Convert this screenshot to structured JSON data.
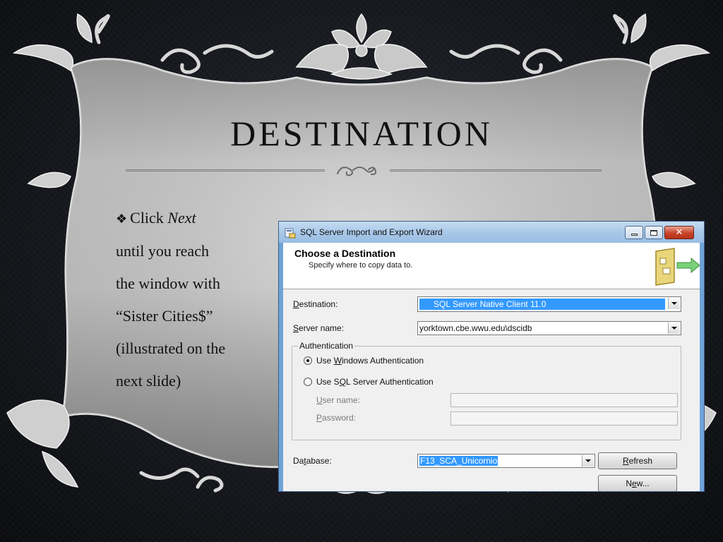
{
  "slide": {
    "title": "DESTINATION",
    "bullet_symbol": "❖",
    "bullet_lines": [
      {
        "pre": "Click ",
        "em": "Next"
      },
      {
        "text": "until you reach"
      },
      {
        "text": "the window with"
      },
      {
        "text": "“Sister Cities$”"
      },
      {
        "text": "(illustrated on the"
      },
      {
        "text": "next slide)"
      }
    ]
  },
  "dialog": {
    "window_title": "SQL Server Import and Export Wizard",
    "header_title": "Choose a Destination",
    "header_subtitle": "Specify where to copy data to.",
    "destination_label_u": "D",
    "destination_label_rest": "estination:",
    "destination_value": "SQL Server Native Client 11.0",
    "server_label_u": "S",
    "server_label_rest": "erver name:",
    "server_value": "yorktown.cbe.wwu.edu\\dscidb",
    "auth_legend": "Authentication",
    "windows_auth_pre": "Use ",
    "windows_auth_u": "W",
    "windows_auth_rest": "indows Authentication",
    "windows_auth_checked": true,
    "sql_auth_pre": "Use S",
    "sql_auth_u": "Q",
    "sql_auth_rest": "L Server Authentication",
    "sql_auth_checked": false,
    "username_u": "U",
    "username_rest": "ser name:",
    "username_value": "",
    "password_u": "P",
    "password_rest": "assword:",
    "password_value": "",
    "database_pre": "Da",
    "database_u": "t",
    "database_rest": "abase:",
    "database_value": "F13_SCA_Unicornio",
    "refresh_u": "R",
    "refresh_rest": "efresh",
    "new_pre": "N",
    "new_u": "e",
    "new_rest": "w..."
  },
  "colors": {
    "selection": "#3399ff",
    "titlebar": "#a9c8e8",
    "close_button": "#c7432a",
    "slide_panel": "#bdbdbd"
  },
  "icons": {
    "app": "wizard-app-icon",
    "header": "destination-wizard-icon",
    "provider": "database-icon"
  }
}
